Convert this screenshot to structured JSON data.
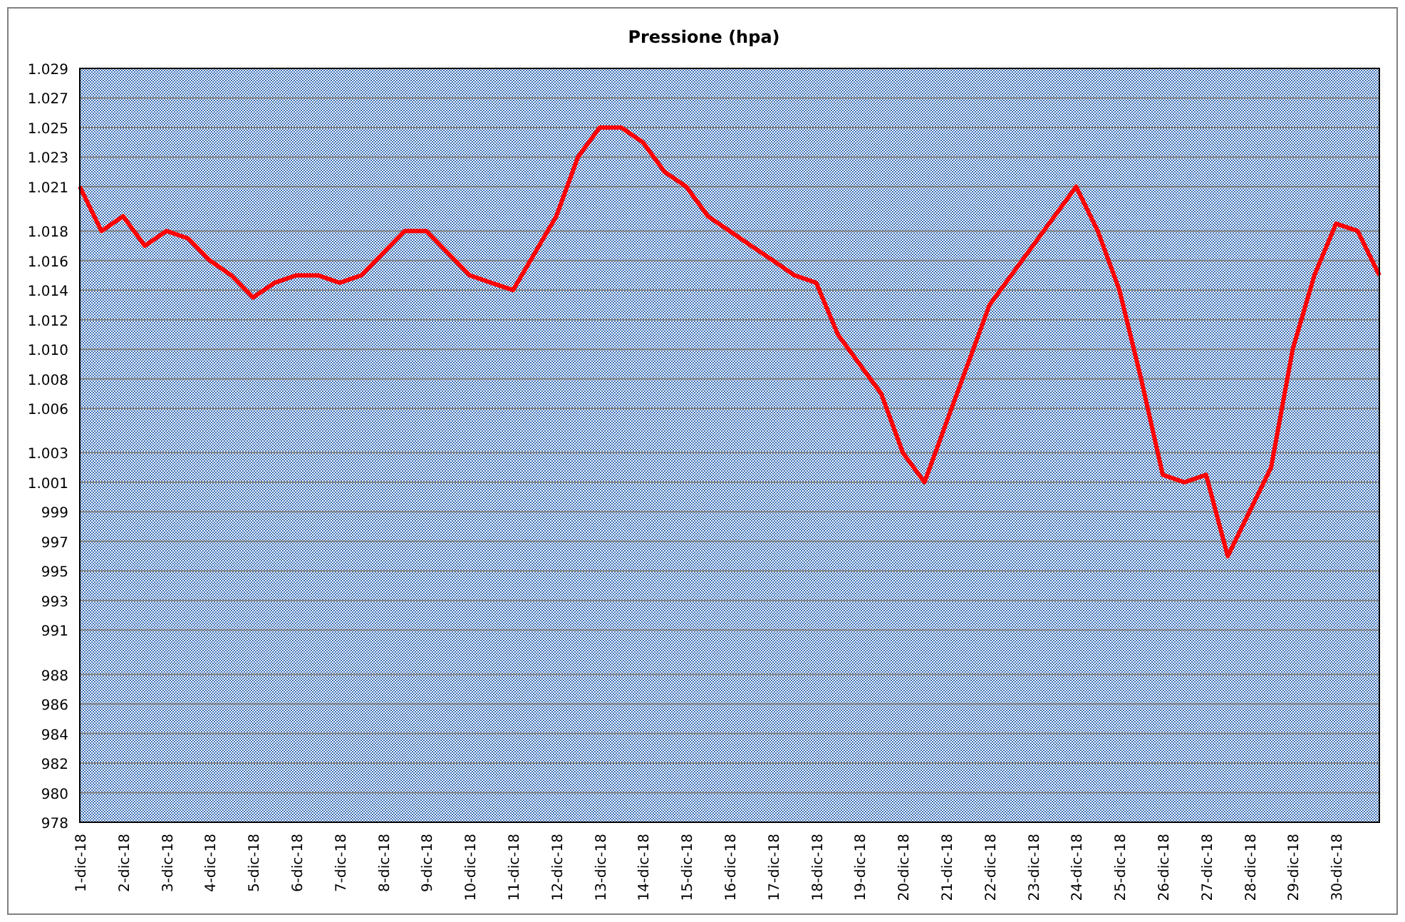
{
  "chart_data": {
    "type": "line",
    "title": "Pressione (hpa)",
    "categories": [
      "1-dic-18",
      null,
      "2-dic-18",
      null,
      "3-dic-18",
      null,
      "4-dic-18",
      null,
      "5-dic-18",
      null,
      "6-dic-18",
      null,
      "7-dic-18",
      null,
      "8-dic-18",
      null,
      "9-dic-18",
      null,
      "10-dic-18",
      null,
      "11-dic-18",
      null,
      "12-dic-18",
      null,
      "13-dic-18",
      null,
      "14-dic-18",
      null,
      "15-dic-18",
      null,
      "16-dic-18",
      null,
      "17-dic-18",
      null,
      "18-dic-18",
      null,
      "19-dic-18",
      null,
      "20-dic-18",
      null,
      "21-dic-18",
      null,
      "22-dic-18",
      null,
      "23-dic-18",
      null,
      "24-dic-18",
      null,
      "25-dic-18",
      null,
      "26-dic-18",
      null,
      "27-dic-18",
      null,
      "28-dic-18",
      null,
      "29-dic-18",
      null,
      "30-dic-18",
      null,
      null
    ],
    "series": [
      {
        "color": "#ff0000",
        "values": [
          1021,
          1018,
          1019,
          1017,
          1018,
          1017.5,
          1016,
          1015,
          1013.5,
          1014.5,
          1015,
          1015,
          1014.5,
          1015,
          1016.5,
          1018,
          1018,
          1016.5,
          1015,
          1014.5,
          1014,
          1016.5,
          1019,
          1023,
          1025,
          1025,
          1024,
          1022,
          1021,
          1019,
          1018,
          1017,
          1016,
          1015,
          1014.5,
          1011,
          1009,
          1007,
          1003,
          1001,
          1005,
          1009,
          1013,
          1015,
          1017,
          1019,
          1021,
          1018,
          1014,
          1008,
          1001.5,
          1001,
          1001.5,
          996,
          999,
          1002,
          1010,
          1015,
          1018.5,
          1018,
          1015
        ]
      }
    ],
    "ylim": [
      978,
      1029
    ],
    "grid": true,
    "yticks": [
      {
        "value": 978,
        "label": "978"
      },
      {
        "value": 980,
        "label": "980"
      },
      {
        "value": 982,
        "label": "982"
      },
      {
        "value": 984,
        "label": "984"
      },
      {
        "value": 986,
        "label": "986"
      },
      {
        "value": 988,
        "label": "988"
      },
      {
        "value": 991,
        "label": "991"
      },
      {
        "value": 993,
        "label": "993"
      },
      {
        "value": 995,
        "label": "995"
      },
      {
        "value": 997,
        "label": "997"
      },
      {
        "value": 999,
        "label": "999"
      },
      {
        "value": 1001,
        "label": "1.001"
      },
      {
        "value": 1003,
        "label": "1.003"
      },
      {
        "value": 1006,
        "label": "1.006"
      },
      {
        "value": 1008,
        "label": "1.008"
      },
      {
        "value": 1010,
        "label": "1.010"
      },
      {
        "value": 1012,
        "label": "1.012"
      },
      {
        "value": 1014,
        "label": "1.014"
      },
      {
        "value": 1016,
        "label": "1.016"
      },
      {
        "value": 1018,
        "label": "1.018"
      },
      {
        "value": 1021,
        "label": "1.021"
      },
      {
        "value": 1023,
        "label": "1.023"
      },
      {
        "value": 1025,
        "label": "1.025"
      },
      {
        "value": 1027,
        "label": "1.027"
      },
      {
        "value": 1029,
        "label": "1.029"
      }
    ]
  }
}
